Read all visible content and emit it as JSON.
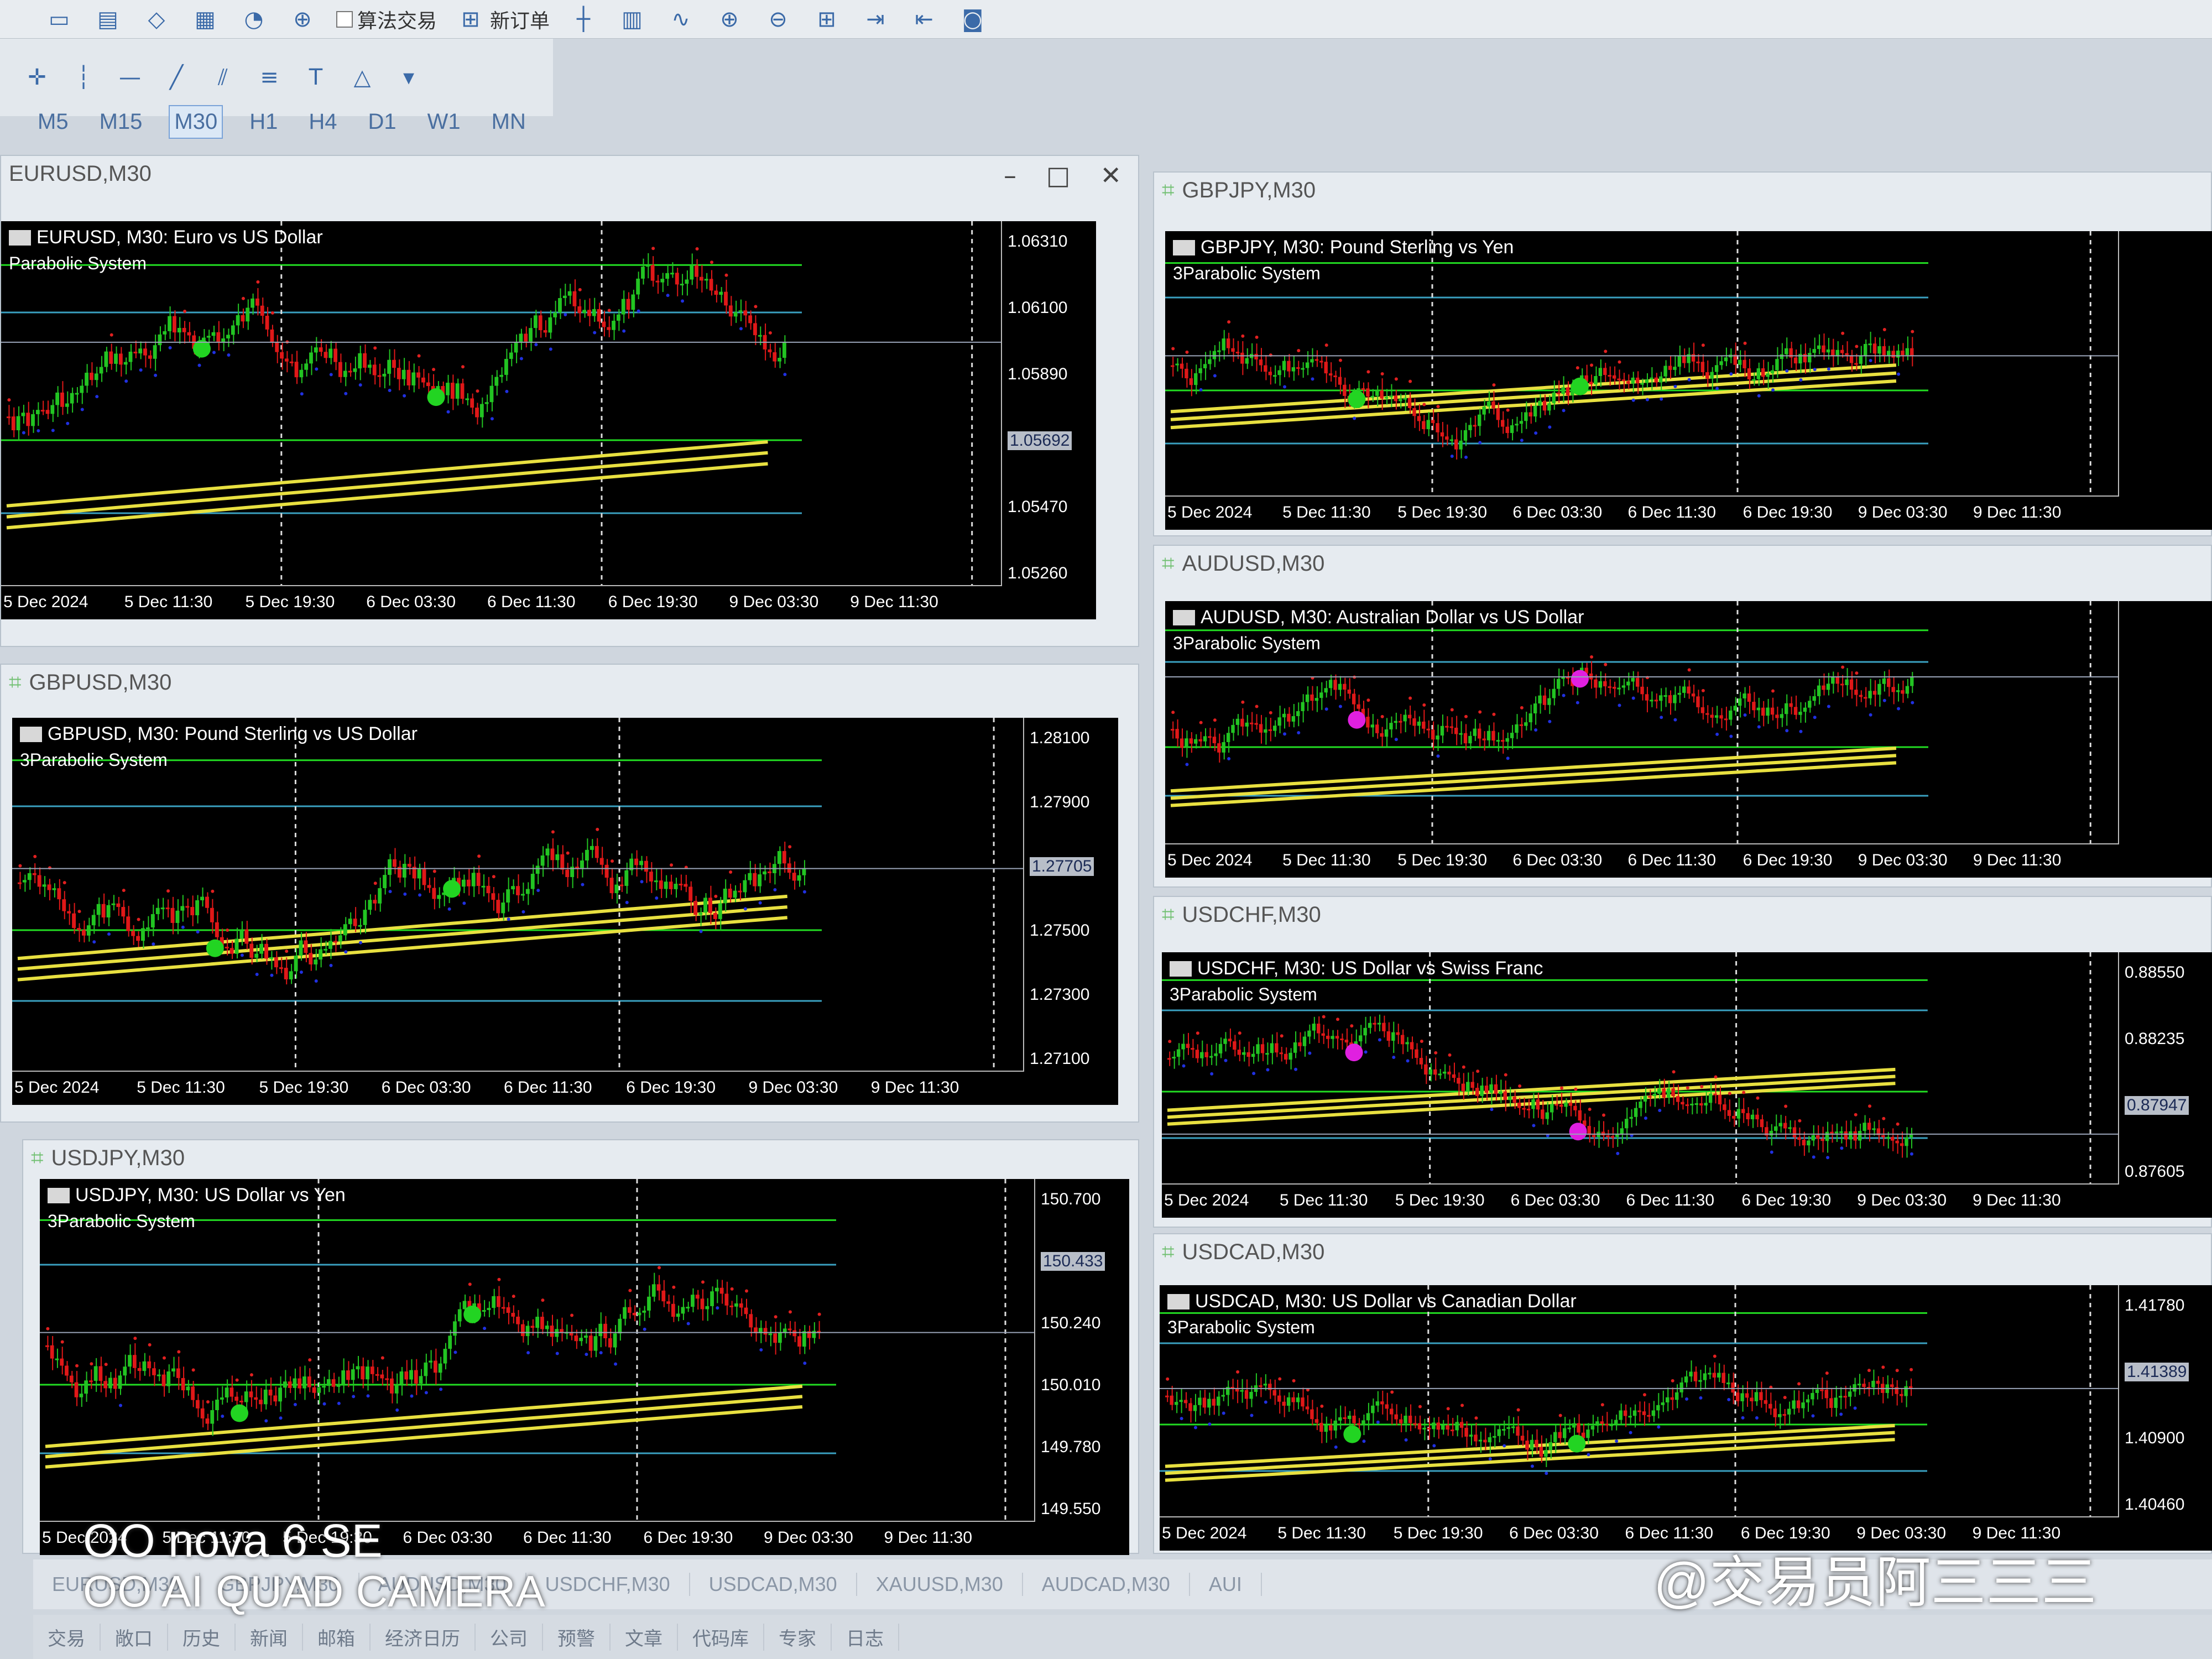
{
  "toolbar": {
    "algo_trading": "算法交易",
    "new_order": "新订单",
    "timeframes": [
      "M5",
      "M15",
      "M30",
      "H1",
      "H4",
      "D1",
      "W1",
      "MN"
    ],
    "active_timeframe": "M30"
  },
  "windows": [
    {
      "id": "eurusd",
      "tab_title": "EURUSD,M30",
      "header": "EURUSD, M30:  Euro vs US Dollar",
      "indicator": "Parabolic System",
      "prices": [
        "1.06310",
        "1.06100",
        "1.05890",
        "1.05692",
        "1.05470",
        "1.05260"
      ],
      "current": "1.05692",
      "times": [
        "5 Dec 2024",
        "5 Dec 11:30",
        "5 Dec 19:30",
        "6 Dec 03:30",
        "6 Dec 11:30",
        "6 Dec 19:30",
        "9 Dec 03:30",
        "9 Dec 11:30"
      ]
    },
    {
      "id": "gbpusd",
      "tab_title": "GBPUSD,M30",
      "header": "GBPUSD, M30:  Pound Sterling vs US Dollar",
      "indicator": "3Parabolic System",
      "prices": [
        "1.28100",
        "1.27900",
        "1.27705",
        "1.27500",
        "1.27300",
        "1.27100"
      ],
      "current": "1.27705",
      "times": [
        "5 Dec 2024",
        "5 Dec 11:30",
        "5 Dec 19:30",
        "6 Dec 03:30",
        "6 Dec 11:30",
        "6 Dec 19:30",
        "9 Dec 03:30",
        "9 Dec 11:30"
      ]
    },
    {
      "id": "usdjpy",
      "tab_title": "USDJPY,M30",
      "header": "USDJPY, M30:  US Dollar vs Yen",
      "indicator": "3Parabolic System",
      "prices": [
        "150.700",
        "150.433",
        "150.240",
        "150.010",
        "149.780",
        "149.550"
      ],
      "current": "150.433",
      "times": [
        "5 Dec 2024",
        "5 Dec 11:30",
        "5 Dec 19:30",
        "6 Dec 03:30",
        "6 Dec 11:30",
        "6 Dec 19:30",
        "9 Dec 03:30",
        "9 Dec 11:30"
      ]
    },
    {
      "id": "gbpjpy",
      "tab_title": "GBPJPY,M30",
      "header": "GBPJPY, M30:  Pound Sterling vs Yen",
      "indicator": "3Parabolic System",
      "prices": [],
      "current": "",
      "times": [
        "5 Dec 2024",
        "5 Dec 11:30",
        "5 Dec 19:30",
        "6 Dec 03:30",
        "6 Dec 11:30",
        "6 Dec 19:30",
        "9 Dec 03:30",
        "9 Dec 11:30"
      ]
    },
    {
      "id": "audusd",
      "tab_title": "AUDUSD,M30",
      "header": "AUDUSD, M30:  Australian Dollar vs US Dollar",
      "indicator": "3Parabolic System",
      "prices": [],
      "current": "",
      "times": [
        "5 Dec 2024",
        "5 Dec 11:30",
        "5 Dec 19:30",
        "6 Dec 03:30",
        "6 Dec 11:30",
        "6 Dec 19:30",
        "9 Dec 03:30",
        "9 Dec 11:30"
      ]
    },
    {
      "id": "usdchf",
      "tab_title": "USDCHF,M30",
      "header": "USDCHF, M30:  US Dollar vs Swiss Franc",
      "indicator": "3Parabolic System",
      "prices": [
        "0.88550",
        "0.88235",
        "0.87947",
        "0.87605"
      ],
      "current": "0.87947",
      "times": [
        "5 Dec 2024",
        "5 Dec 11:30",
        "5 Dec 19:30",
        "6 Dec 03:30",
        "6 Dec 11:30",
        "6 Dec 19:30",
        "9 Dec 03:30",
        "9 Dec 11:30"
      ]
    },
    {
      "id": "usdcad",
      "tab_title": "USDCAD,M30",
      "header": "USDCAD, M30:  US Dollar vs Canadian Dollar",
      "indicator": "3Parabolic System",
      "prices": [
        "1.41780",
        "1.41389",
        "1.40900",
        "1.40460"
      ],
      "current": "1.41389",
      "times": [
        "5 Dec 2024",
        "5 Dec 11:30",
        "5 Dec 19:30",
        "6 Dec 03:30",
        "6 Dec 11:30",
        "6 Dec 19:30",
        "9 Dec 03:30",
        "9 Dec 11:30"
      ]
    }
  ],
  "symbol_tabs": [
    "EURUSD,M30",
    "GBPJPY,M30",
    "AUDUSD,M30",
    "USDCHF,M30",
    "USDCAD,M30",
    "XAUUSD,M30",
    "AUDCAD,M30",
    "AUI"
  ],
  "terminal_tabs": [
    "交易",
    "敞口",
    "历史",
    "新闻",
    "邮箱",
    "经济日历",
    "公司",
    "预警",
    "文章",
    "代码库",
    "专家",
    "日志"
  ],
  "watermark": {
    "camera_line1": "nova 6 SE",
    "camera_line2": "AI QUAD CAMERA",
    "user": "@交易员阿三三三"
  },
  "colors": {
    "bull": "#22c422",
    "bear": "#e01818",
    "sar_bear": "#e02020",
    "sar_bull": "#2030e0",
    "ma": "#e8e040",
    "level_green": "#22dd22",
    "level_cyan": "#3aa0c0",
    "dot_green": "#22d422",
    "dot_magenta": "#e020e0"
  }
}
